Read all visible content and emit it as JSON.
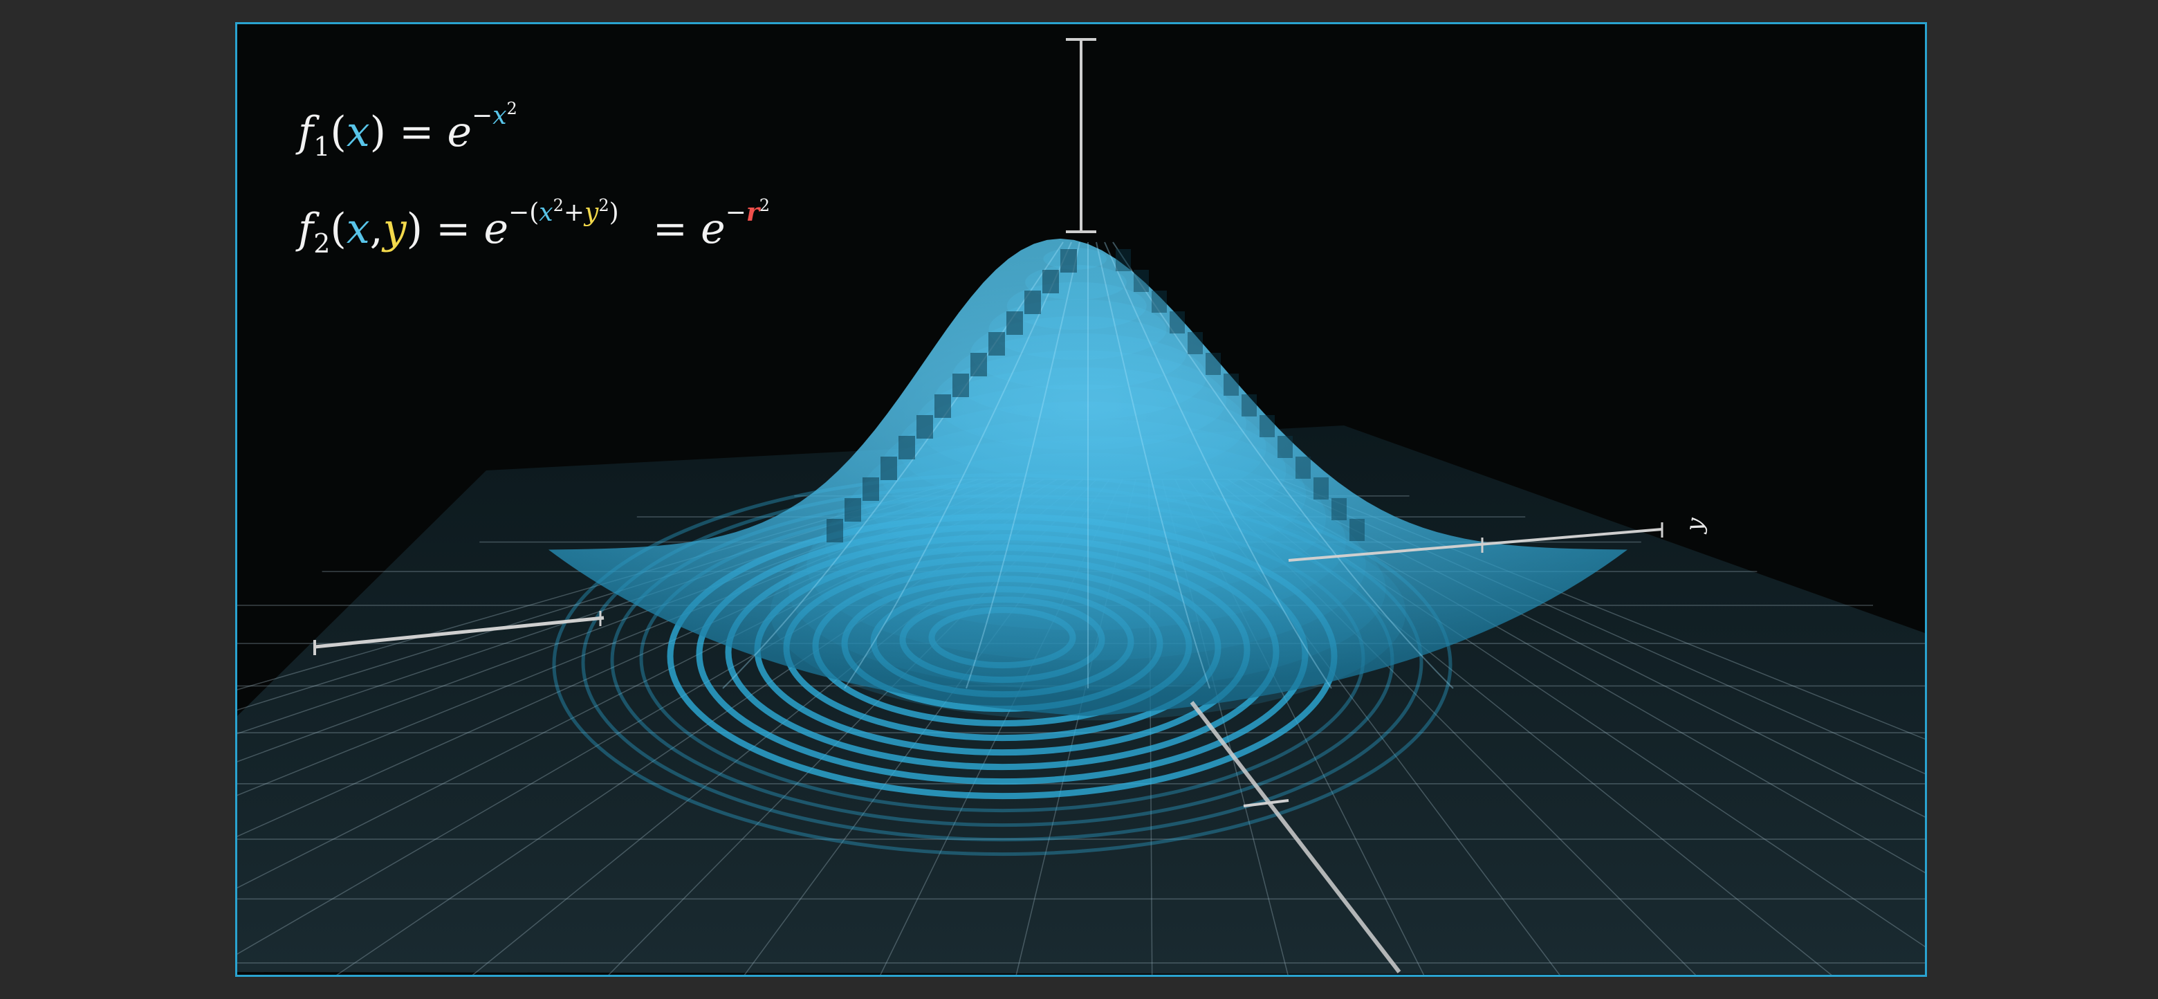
{
  "equations": {
    "f1": {
      "name": "f",
      "index": "1",
      "var_x": "x",
      "base": "e",
      "sign": "−",
      "exp_var": "x",
      "power": "2"
    },
    "f2": {
      "name": "f",
      "index": "2",
      "var_x": "x",
      "comma": ",",
      "var_y": "y",
      "base": "e",
      "sign": "−",
      "lparen": "(",
      "exp_x": "x",
      "power_x": "2",
      "plus": "+",
      "exp_y": "y",
      "power_y": "2",
      "rparen": ")"
    },
    "r_form": {
      "eq": "=",
      "base": "e",
      "sign": "−",
      "var_r": "r",
      "power": "2"
    },
    "eq_sign": "="
  },
  "axes": {
    "y_axis_label": "y"
  },
  "colors": {
    "x": "#58c4e8",
    "y": "#f3d94b",
    "r": "#f0504c",
    "surface": "#2fb4e4",
    "grid": "#9fb7c2",
    "frame": "#2aa3d0"
  }
}
